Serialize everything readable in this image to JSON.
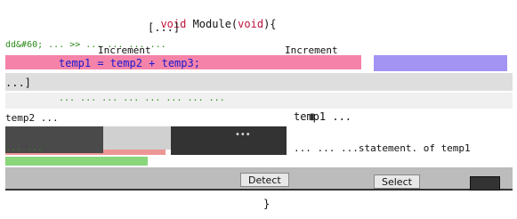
{
  "code": {
    "signature_kw": "void",
    "signature_name": " Module(",
    "signature_arg": "void",
    "signature_end": "){",
    "ellipsis": "[...]",
    "comment_line": "dd&#60; ... >> ... ... ... ...",
    "increment_label": "Increment",
    "increment_label_2": "Increment",
    "assign_line": "temp1 = temp2 + temp3;",
    "bracket_line": "...]",
    "long_comment": "... ... ... ... ... ... ... ...",
    "temp_line_right": "temp1 ...",
    "temp_line_left": "temp2 ...",
    "case_line": "... ...",
    "right_comment": "... ... ...statement. of temp1",
    "closing_brace": "}"
  },
  "buttons": {
    "detect_label": "Detect",
    "select_label": "Select"
  },
  "colors": {
    "keyword": "#c0143c",
    "code_blue": "#1a1acc",
    "comment_green": "#2a8a1a",
    "highlight_pink": "#f25a8c",
    "highlight_violet": "#8c78f0",
    "band_gray": "#c8c8c8",
    "panel_dark": "#333333"
  }
}
